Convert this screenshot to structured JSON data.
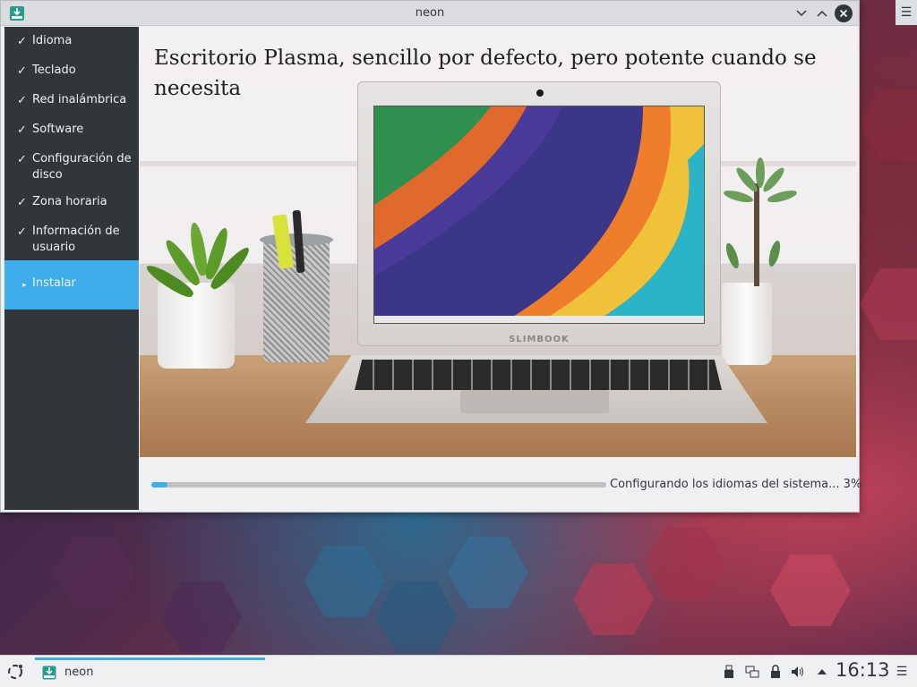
{
  "window": {
    "title": "neon",
    "app_icon": "installer-download-icon",
    "buttons": [
      "minimize-icon",
      "maximize-icon",
      "close-icon"
    ]
  },
  "sidebar": {
    "steps": [
      {
        "label": "Idioma",
        "state": "done",
        "mark": "✓"
      },
      {
        "label": "Teclado",
        "state": "done",
        "mark": "✓"
      },
      {
        "label": "Red inalámbrica",
        "state": "done",
        "mark": "✓"
      },
      {
        "label": "Software",
        "state": "done",
        "mark": "✓"
      },
      {
        "label": "Configuración de disco",
        "state": "done",
        "mark": "✓"
      },
      {
        "label": "Zona horaria",
        "state": "done",
        "mark": "✓"
      },
      {
        "label": "Información de usuario",
        "state": "done",
        "mark": "✓"
      },
      {
        "label": "Instalar",
        "state": "active",
        "mark": "▸"
      }
    ]
  },
  "slide": {
    "title": "Escritorio Plasma, sencillo por defecto, pero potente cuando se necesita",
    "laptop_brand": "SLIMBOOK"
  },
  "progress": {
    "percent": 3,
    "text": "Configurando los idiomas del sistema... 3%"
  },
  "taskbar": {
    "task_label": "neon",
    "clock": "16:13",
    "tray_icons": [
      "usb-device-icon",
      "network-icon",
      "lock-icon",
      "volume-icon",
      "expand-tray-icon"
    ]
  },
  "colors": {
    "accent": "#3daee9",
    "sidebar_bg": "#31363b",
    "window_bg": "#eff0f1"
  }
}
